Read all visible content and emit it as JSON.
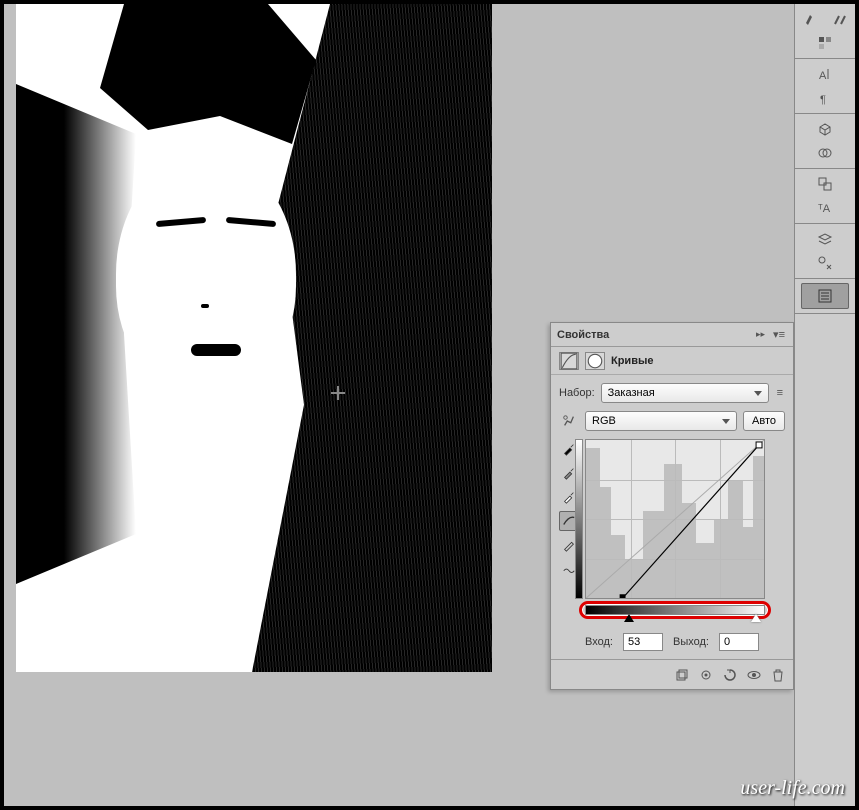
{
  "panel": {
    "title": "Свойства",
    "adjustment_name": "Кривые",
    "preset_label": "Набор:",
    "preset_value": "Заказная",
    "channel_value": "RGB",
    "auto_label": "Авто",
    "input_label": "Вход:",
    "input_value": "53",
    "output_label": "Выход:",
    "output_value": "0"
  },
  "toolbar": {
    "tools": [
      "brushes-icon",
      "swatches-icon",
      "character-icon",
      "paragraph-icon",
      "3d-icon",
      "materials-icon",
      "clone-source-icon",
      "character-styles-icon",
      "layers-icon",
      "edit-tools-icon",
      "properties-icon"
    ]
  },
  "watermark": "user-life.com"
}
